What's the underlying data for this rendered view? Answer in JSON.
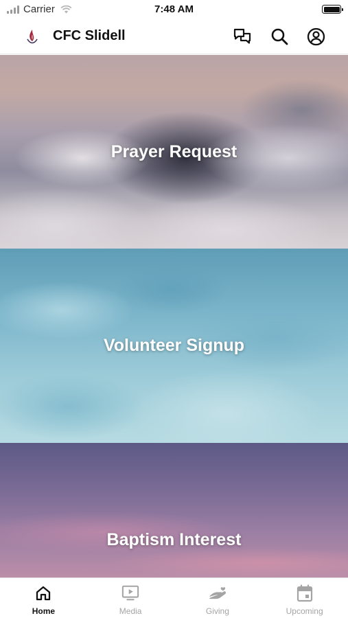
{
  "status_bar": {
    "carrier": "Carrier",
    "time": "7:48 AM"
  },
  "header": {
    "title": "CFC Slidell",
    "logo_icon": "church-flame-logo",
    "actions": [
      "chat-bubbles-icon",
      "search-icon",
      "profile-icon"
    ]
  },
  "cards": [
    {
      "label": "Prayer Request",
      "image": "mountain-clouds"
    },
    {
      "label": "Volunteer Signup",
      "image": "blue-water-ripples"
    },
    {
      "label": "Baptism Interest",
      "image": "purple-pink-sky"
    }
  ],
  "tabs": [
    {
      "label": "Home",
      "icon": "home-icon",
      "active": true
    },
    {
      "label": "Media",
      "icon": "tv-play-icon",
      "active": false
    },
    {
      "label": "Giving",
      "icon": "giving-hand-icon",
      "active": false
    },
    {
      "label": "Upcoming",
      "icon": "calendar-icon",
      "active": false
    }
  ],
  "colors": {
    "active_tab": "#111111",
    "inactive_tab": "#a4a4a4",
    "logo_accent": "#a3263a"
  }
}
